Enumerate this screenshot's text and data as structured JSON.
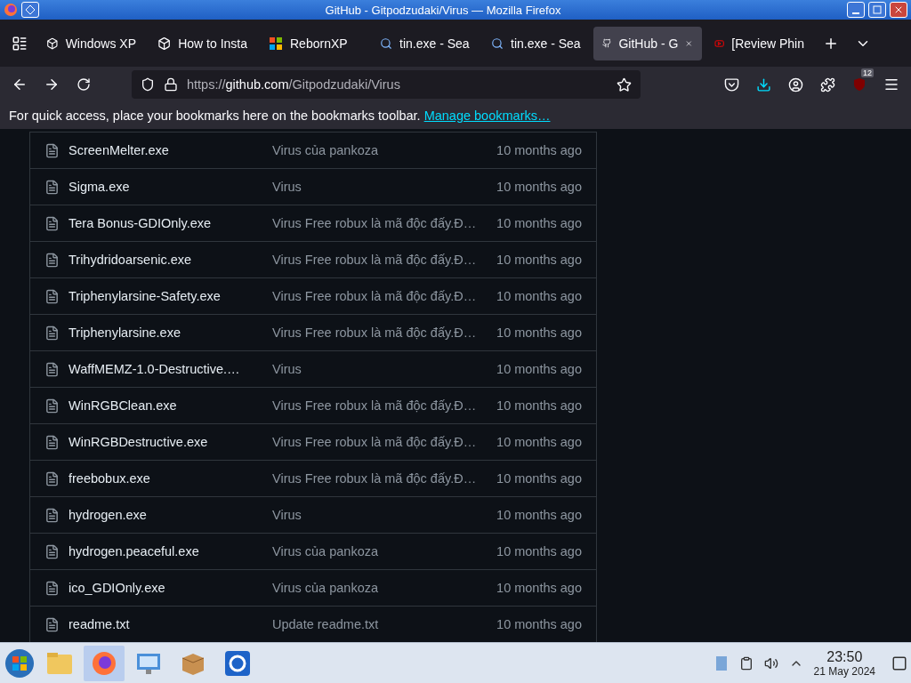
{
  "window": {
    "title": "GitHub - Gitpodzudaki/Virus — Mozilla Firefox"
  },
  "tabs": [
    {
      "label": "Windows XP",
      "kind": "cube",
      "selected": false
    },
    {
      "label": "How to Insta",
      "kind": "cube",
      "selected": false
    },
    {
      "label": "RebornXP",
      "kind": "windows",
      "selected": false
    },
    {
      "label": "tin.exe - Sea",
      "kind": "search",
      "selected": false
    },
    {
      "label": "tin.exe - Sea",
      "kind": "search",
      "selected": false
    },
    {
      "label": "GitHub - G",
      "kind": "github",
      "selected": true
    },
    {
      "label": "[Review Phin",
      "kind": "youtube",
      "selected": false
    }
  ],
  "address": {
    "scheme": "https://",
    "host": "github.com",
    "path": "/Gitpodzudaki/Virus"
  },
  "extension_badge": "12",
  "bookmarks_bar": {
    "message": "For quick access, place your bookmarks here on the bookmarks toolbar.",
    "link": "Manage bookmarks…"
  },
  "files": [
    {
      "name": "ScreenMelter.exe",
      "message": "Virus của pankoza",
      "time": "10 months ago"
    },
    {
      "name": "Sigma.exe",
      "message": "Virus",
      "time": "10 months ago"
    },
    {
      "name": "Tera Bonus-GDIOnly.exe",
      "message": "Virus Free robux là mã độc đấy.Đ…",
      "time": "10 months ago"
    },
    {
      "name": "Trihydridoarsenic.exe",
      "message": "Virus Free robux là mã độc đấy.Đ…",
      "time": "10 months ago"
    },
    {
      "name": "Triphenylarsine-Safety.exe",
      "message": "Virus Free robux là mã độc đấy.Đ…",
      "time": "10 months ago"
    },
    {
      "name": "Triphenylarsine.exe",
      "message": "Virus Free robux là mã độc đấy.Đ…",
      "time": "10 months ago"
    },
    {
      "name": "WaffMEMZ-1.0-Destructive.…",
      "message": "Virus",
      "time": "10 months ago"
    },
    {
      "name": "WinRGBClean.exe",
      "message": "Virus Free robux là mã độc đấy.Đ…",
      "time": "10 months ago"
    },
    {
      "name": "WinRGBDestructive.exe",
      "message": "Virus Free robux là mã độc đấy.Đ…",
      "time": "10 months ago"
    },
    {
      "name": "freebobux.exe",
      "message": "Virus Free robux là mã độc đấy.Đ…",
      "time": "10 months ago"
    },
    {
      "name": "hydrogen.exe",
      "message": "Virus",
      "time": "10 months ago"
    },
    {
      "name": "hydrogen.peaceful.exe",
      "message": "Virus của pankoza",
      "time": "10 months ago"
    },
    {
      "name": "ico_GDIOnly.exe",
      "message": "Virus của pankoza",
      "time": "10 months ago"
    },
    {
      "name": "readme.txt",
      "message": "Update readme.txt",
      "time": "10 months ago"
    }
  ],
  "taskbar": {
    "time": "23:50",
    "date": "21 May 2024"
  }
}
